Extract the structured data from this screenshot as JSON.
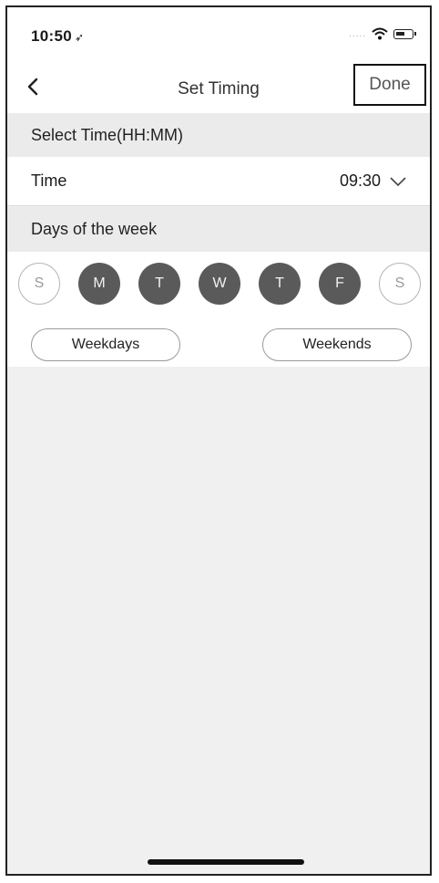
{
  "status_bar": {
    "time": "10:50",
    "signal": "....."
  },
  "nav": {
    "title": "Set Timing",
    "done_label": "Done"
  },
  "time_section": {
    "header": "Select Time(HH:MM)",
    "label": "Time",
    "value": "09:30"
  },
  "days_section": {
    "header": "Days of the week",
    "days": [
      {
        "label": "S",
        "selected": false
      },
      {
        "label": "M",
        "selected": true
      },
      {
        "label": "T",
        "selected": true
      },
      {
        "label": "W",
        "selected": true
      },
      {
        "label": "T",
        "selected": true
      },
      {
        "label": "F",
        "selected": true
      },
      {
        "label": "S",
        "selected": false
      }
    ],
    "weekdays_label": "Weekdays",
    "weekends_label": "Weekends"
  },
  "colors": {
    "selected_day": "#5a5a5a",
    "background": "#f0f0f0"
  }
}
